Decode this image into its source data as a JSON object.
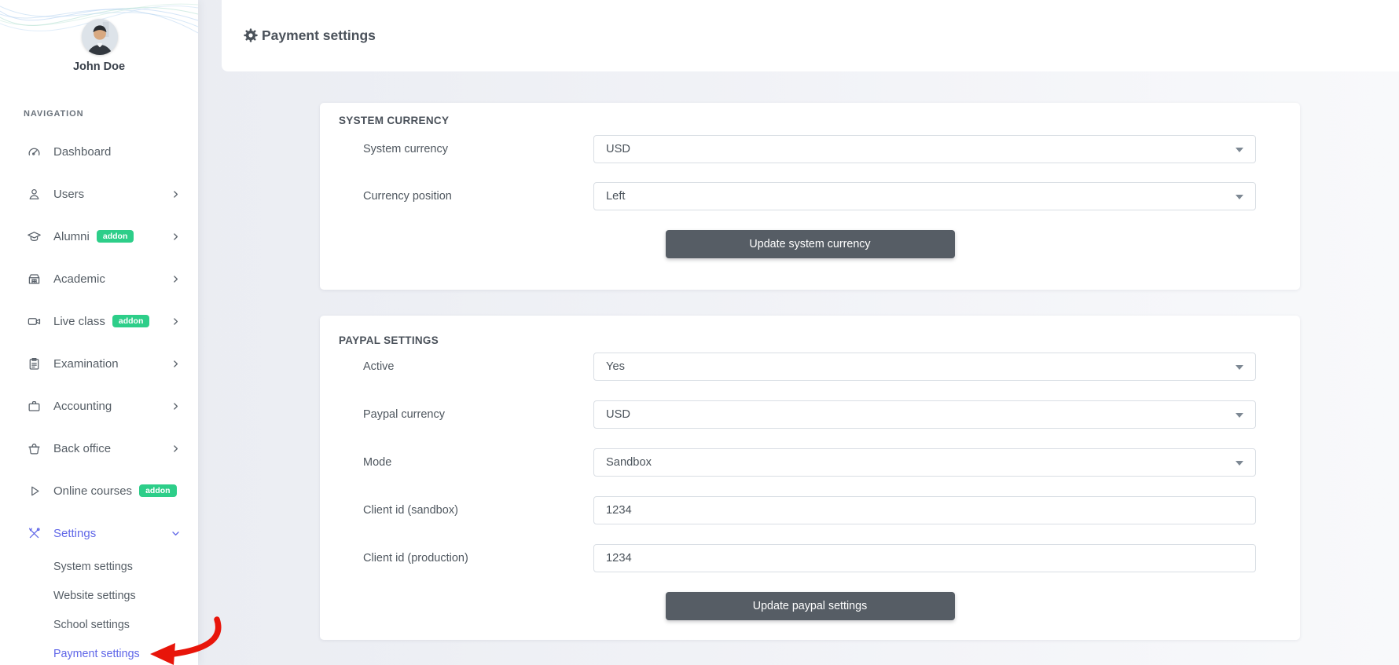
{
  "sidebar": {
    "user_name": "John Doe",
    "section_label": "NAVIGATION",
    "items": [
      {
        "label": "Dashboard",
        "icon": "gauge",
        "chevron": "none",
        "badge": null,
        "active": false
      },
      {
        "label": "Users",
        "icon": "user",
        "chevron": "right",
        "badge": null,
        "active": false
      },
      {
        "label": "Alumni",
        "icon": "grad-cap",
        "chevron": "right",
        "badge": "addon",
        "active": false
      },
      {
        "label": "Academic",
        "icon": "school",
        "chevron": "right",
        "badge": null,
        "active": false
      },
      {
        "label": "Live class",
        "icon": "video",
        "chevron": "right",
        "badge": "addon",
        "active": false
      },
      {
        "label": "Examination",
        "icon": "clipboard",
        "chevron": "right",
        "badge": null,
        "active": false
      },
      {
        "label": "Accounting",
        "icon": "briefcase",
        "chevron": "right",
        "badge": null,
        "active": false
      },
      {
        "label": "Back office",
        "icon": "basket",
        "chevron": "right",
        "badge": null,
        "active": false
      },
      {
        "label": "Online courses",
        "icon": "play",
        "chevron": "none",
        "badge": "addon",
        "active": false
      },
      {
        "label": "Settings",
        "icon": "tools",
        "chevron": "down",
        "badge": null,
        "active": true
      }
    ],
    "subitems": [
      "System settings",
      "Website settings",
      "School settings",
      "Payment settings"
    ],
    "active_subitem": "Payment settings"
  },
  "header": {
    "title": "Payment settings",
    "icon": "gear"
  },
  "cards": [
    {
      "title": "SYSTEM CURRENCY",
      "fields": [
        {
          "label": "System currency",
          "value": "USD",
          "type": "select"
        },
        {
          "label": "Currency position",
          "value": "Left",
          "type": "select"
        }
      ],
      "button": "Update system currency"
    },
    {
      "title": "PAYPAL SETTINGS",
      "fields": [
        {
          "label": "Active",
          "value": "Yes",
          "type": "select"
        },
        {
          "label": "Paypal currency",
          "value": "USD",
          "type": "select"
        },
        {
          "label": "Mode",
          "value": "Sandbox",
          "type": "select"
        },
        {
          "label": "Client id (sandbox)",
          "value": "1234",
          "type": "text"
        },
        {
          "label": "Client id (production)",
          "value": "1234",
          "type": "text"
        }
      ],
      "button": "Update paypal settings"
    }
  ],
  "colors": {
    "accent_indigo": "#6168e8",
    "badge_green": "#2dce89",
    "button_slate": "#565d65",
    "annotation_arrow_red": "#e8150a",
    "title_text": "#4b525b",
    "border": "#d9dee4"
  }
}
